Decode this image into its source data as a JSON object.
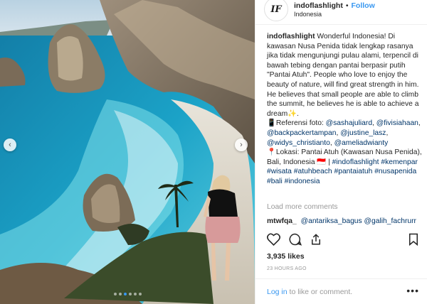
{
  "post": {
    "username": "indoflashlight",
    "separator": "•",
    "follow_label": "Follow",
    "location": "Indonesia",
    "avatar_text": "IF",
    "carousel": {
      "slides": 6,
      "active_index": 2
    }
  },
  "caption": {
    "username": "indoflashlight",
    "line_parts": [
      {
        "text": " Wonderful Indonesia! Di kawasan Nusa Penida tidak lengkap rasanya jika tidak mengunjungi pulau alami, terpencil di bawah tebing dengan pantai berpasir putih \"Pantai Atuh\". People who love to enjoy the beauty of nature, will find great strength in him. He believes that small people are able to climb the summit, he believes he is able to achieve a dream✨."
      }
    ],
    "credits_prefix": "📱Referensi foto: ",
    "credits": [
      "@sashajuliard",
      "@fivisiahaan",
      "@backpackertampan",
      "@justine_lasz",
      "@widys_christianto",
      "@ameliadwianty"
    ],
    "location_prefix": "📍Lokasi: Pantai Atuh (Kawasan Nusa Penida), Bali, Indonesia 🇮🇩 | ",
    "hashtags": [
      "#indoflashlight",
      "#kemenpar",
      "#wisata",
      "#atuhbeach",
      "#pantaiatuh",
      "#nusapenida",
      "#bali",
      "#indonesia"
    ]
  },
  "load_more": "Load more comments",
  "comment": {
    "username": "mtwfqa_",
    "mentions": [
      "@antariksa_bagus",
      "@galih_fachrurr"
    ]
  },
  "likes": "3,935 likes",
  "time": "23 HOURS AGO",
  "footer": {
    "login_link": "Log in",
    "login_rest": " to like or comment.",
    "more": "•••"
  },
  "icons": {
    "like": "heart-icon",
    "comment": "comment-icon",
    "share": "share-icon",
    "save": "bookmark-icon",
    "prev": "chevron-left-icon",
    "next": "chevron-right-icon"
  },
  "colors": {
    "link": "#3897f0",
    "hashtag": "#003569",
    "muted": "#999999",
    "text": "#262626"
  }
}
